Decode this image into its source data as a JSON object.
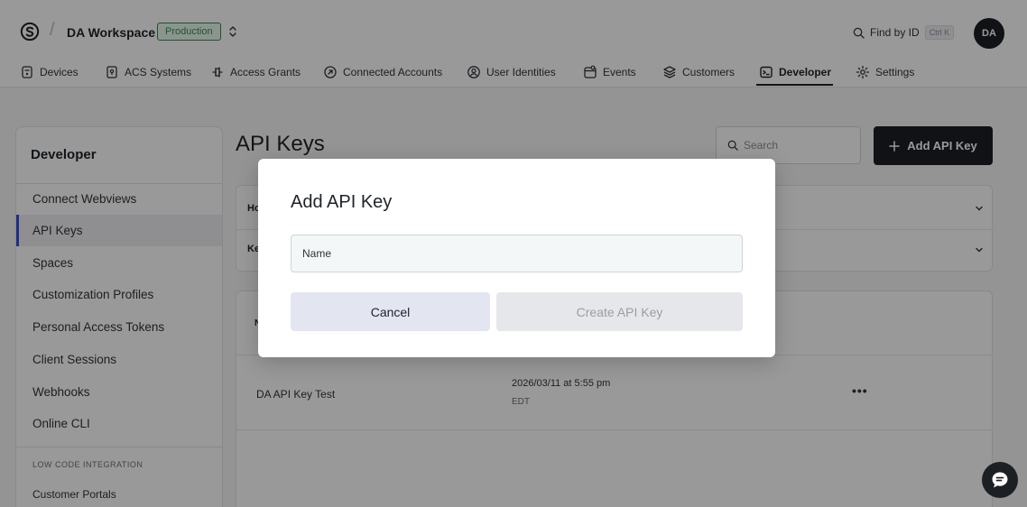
{
  "header": {
    "workspace_name": "DA Workspace",
    "environment_badge": "Production",
    "find_label": "Find by ID",
    "find_shortcut": "Ctrl K",
    "avatar_initials": "DA"
  },
  "nav": {
    "items": [
      {
        "label": "Devices",
        "icon": "device-icon"
      },
      {
        "label": "ACS Systems",
        "icon": "acs-icon"
      },
      {
        "label": "Access Grants",
        "icon": "key-icon"
      },
      {
        "label": "Connected Accounts",
        "icon": "link-icon"
      },
      {
        "label": "User Identities",
        "icon": "user-icon"
      },
      {
        "label": "Events",
        "icon": "events-icon"
      },
      {
        "label": "Customers",
        "icon": "layers-icon"
      },
      {
        "label": "Developer",
        "icon": "terminal-icon"
      },
      {
        "label": "Settings",
        "icon": "gear-icon"
      }
    ],
    "active": "Developer"
  },
  "sidebar": {
    "title": "Developer",
    "items": [
      {
        "label": "Connect Webviews"
      },
      {
        "label": "API Keys"
      },
      {
        "label": "Spaces"
      },
      {
        "label": "Customization Profiles"
      },
      {
        "label": "Personal Access Tokens"
      },
      {
        "label": "Client Sessions"
      },
      {
        "label": "Webhooks"
      },
      {
        "label": "Online CLI"
      }
    ],
    "active": "API Keys",
    "section_label": "LOW CODE INTEGRATION",
    "section_items": [
      {
        "label": "Customer Portals"
      }
    ]
  },
  "main": {
    "title": "API Keys",
    "search_placeholder": "Search",
    "add_button_label": "Add API Key",
    "info_rows": [
      {
        "label": "Ho"
      },
      {
        "label": "Ke"
      }
    ],
    "table": {
      "header_first": "N",
      "rows": [
        {
          "name": "DA API Key Test",
          "created": "2026/03/11 at 5:55 pm",
          "timezone": "EDT",
          "more": "•••"
        }
      ]
    }
  },
  "modal": {
    "title": "Add API Key",
    "name_placeholder": "Name",
    "name_value": "",
    "cancel_label": "Cancel",
    "create_label": "Create API Key"
  }
}
